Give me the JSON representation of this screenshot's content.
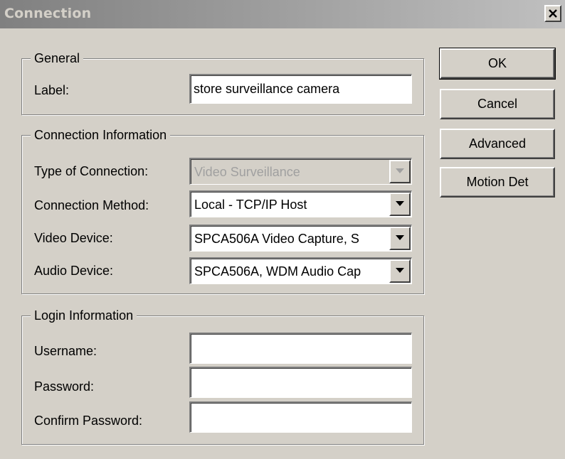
{
  "window": {
    "title": "Connection"
  },
  "general": {
    "legend": "General",
    "label_caption": "Label:",
    "label_value": "store surveillance camera"
  },
  "connection_info": {
    "legend": "Connection Information",
    "type_caption": "Type of Connection:",
    "type_value": "Video Surveillance",
    "method_caption": "Connection Method:",
    "method_value": "Local - TCP/IP Host",
    "video_caption": "Video Device:",
    "video_value": "SPCA506A Video Capture, S",
    "audio_caption": "Audio Device:",
    "audio_value": "SPCA506A, WDM Audio Cap"
  },
  "login_info": {
    "legend": "Login Information",
    "username_caption": "Username:",
    "username_value": "",
    "password_caption": "Password:",
    "password_value": "",
    "confirm_caption": "Confirm Password:",
    "confirm_value": ""
  },
  "buttons": {
    "ok": "OK",
    "cancel": "Cancel",
    "advanced": "Advanced",
    "motion": "Motion Det"
  },
  "icons": {
    "close": "close-icon",
    "dropdown": "chevron-down-icon"
  },
  "colors": {
    "face": "#d4d0c8",
    "title_gradient_start": "#808080",
    "title_gradient_end": "#c0c0c0",
    "disabled_text": "#a0a0a0"
  }
}
